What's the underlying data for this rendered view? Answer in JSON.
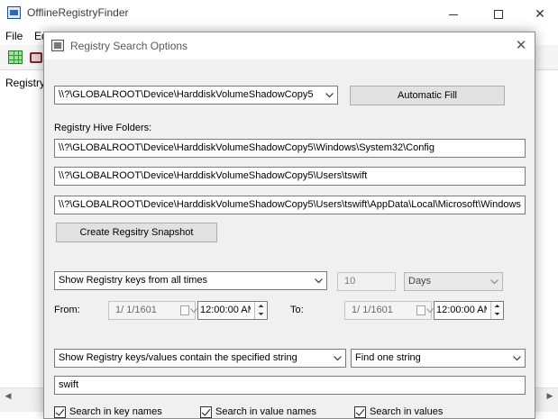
{
  "app": {
    "title": "OfflineRegistryFinder",
    "menu": [
      "File",
      "Ed"
    ],
    "left_panel_label": "Registry"
  },
  "dialog": {
    "title": "Registry Search Options",
    "source_combo": "\\\\?\\GLOBALROOT\\Device\\HarddiskVolumeShadowCopy5",
    "automatic_fill": "Automatic Fill",
    "hive_folders_label": "Registry Hive Folders:",
    "hive_folders": [
      "\\\\?\\GLOBALROOT\\Device\\HarddiskVolumeShadowCopy5\\Windows\\System32\\Config",
      "\\\\?\\GLOBALROOT\\Device\\HarddiskVolumeShadowCopy5\\Users\\tswift",
      "\\\\?\\GLOBALROOT\\Device\\HarddiskVolumeShadowCopy5\\Users\\tswift\\AppData\\Local\\Microsoft\\Windows"
    ],
    "create_snapshot": "Create Regsitry Snapshot",
    "time_filter": "Show Registry keys from all times",
    "time_amount": "10",
    "time_unit": "Days",
    "from_label": "From:",
    "from_date": "1/  1/1601",
    "from_time": "12:00:00 AM",
    "to_label": "To:",
    "to_date": "1/  1/1601",
    "to_time": "12:00:00 AM",
    "string_filter": "Show Registry keys/values contain the specified string",
    "string_mode": "Find one string",
    "search_text": "swift",
    "checkboxes": [
      {
        "label": "Search in key names",
        "checked": true
      },
      {
        "label": "Search in value names",
        "checked": true
      },
      {
        "label": "Search in values",
        "checked": true
      }
    ]
  },
  "colors": {
    "dialog_bg": "#f0f0f0",
    "button_bg": "#e1e1e1",
    "border": "#7a7a7a"
  }
}
